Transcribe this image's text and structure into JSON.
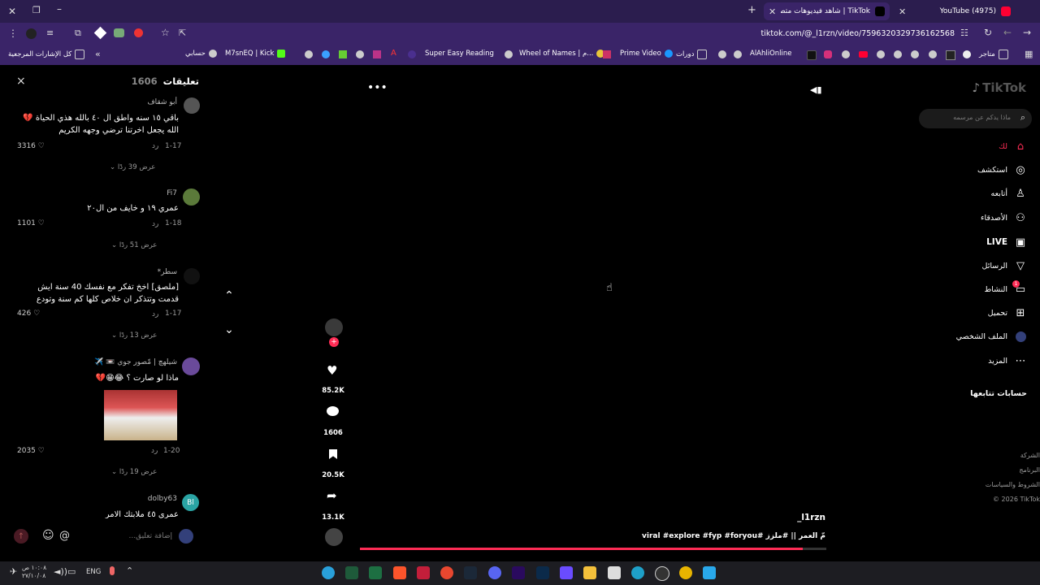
{
  "browser": {
    "tabs": [
      {
        "title": "TikTok | شاهد فيديوهات متصدرة",
        "active": true
      },
      {
        "title": "(4975) YouTube",
        "active": false
      }
    ],
    "new_tab_label": "+",
    "url": "tiktok.com/@_l1rzn/video/7596320329736162568"
  },
  "bookmarks": [
    {
      "label": "كل الإشارات المرجعية",
      "color": "#cccccc"
    },
    {
      "label": "حسابي",
      "color": "#cccccc"
    },
    {
      "label": "M7snEQ | Kick",
      "color": "#53fc18"
    },
    {
      "label": "Super Easy Reading",
      "color": "#4a2f8f"
    },
    {
      "label": "Wheel of Names | م...",
      "color": "#e8c53a"
    },
    {
      "label": "Prime Video",
      "color": "#1a98ff"
    },
    {
      "label": "دورات",
      "color": "#cccccc"
    },
    {
      "label": "AlAhliOnline",
      "color": "#cccccc"
    },
    {
      "label": "متاجر",
      "color": "#cccccc"
    }
  ],
  "comments_panel": {
    "title": "تعليقات",
    "count": "1606",
    "close": "×",
    "reply_label": "رد",
    "comments": [
      {
        "user": "أبو شقاف",
        "text": "باقي ١٥ سنه واطق ال ٤٠ بالله هذي الحياة 💔 الله يجعل اخرتنا ترضي وجهه الكريم",
        "date": "1-17",
        "likes": "3316",
        "replies": "عرض 39 ردًا"
      },
      {
        "user": "Fi7",
        "text": "عمري ١٩ و خايف من ال٢٠",
        "date": "1-18",
        "likes": "1101",
        "replies": "عرض 51 ردًا"
      },
      {
        "user": "سطر*",
        "text": "[ملصق] اخخ تفكر مع نفسك 40 سنة ايش قدمت وتتذكر ان خلاص كلها كم سنة وتودع",
        "date": "1-17",
        "likes": "426",
        "replies": "عرض 13 ردًا"
      },
      {
        "user": "شيلهچ | مّصور جوي 📼 ✈️",
        "text": "ماذا لو صارت ؟ 😂😁💔",
        "date": "1-20",
        "likes": "2035",
        "replies": "عرض 19 ردًا"
      },
      {
        "user": "dolby63",
        "text": "عمري ٤٥ ملابتك الامر",
        "date": "",
        "likes": "",
        "replies": ""
      }
    ],
    "input_placeholder": "إضافة تعليق...",
    "mention": "@"
  },
  "video": {
    "author": "_l1rzn",
    "caption": "مّ العمر || #ملزز #viral #explore #fyp #foryou",
    "progress": 0.95
  },
  "actions": {
    "likes": "85.2K",
    "comments": "1606",
    "saves": "20.5K",
    "shares": "13.1K"
  },
  "sidebar": {
    "logo": "TikTok",
    "search_placeholder": "ماذا يدكم عن مرسمه",
    "items": [
      {
        "label": "لك",
        "icon": "home-icon",
        "active": true
      },
      {
        "label": "استكشف",
        "icon": "compass-icon"
      },
      {
        "label": "أتابعه",
        "icon": "following-icon"
      },
      {
        "label": "الأصدقاء",
        "icon": "friends-icon"
      },
      {
        "label": "LIVE",
        "icon": "live-icon"
      },
      {
        "label": "الرسائل",
        "icon": "send-icon"
      },
      {
        "label": "النشاط",
        "icon": "activity-icon",
        "badge": "1"
      },
      {
        "label": "تحميل",
        "icon": "upload-icon"
      },
      {
        "label": "الملف الشخصي",
        "icon": "profile-icon"
      },
      {
        "label": "المزيد",
        "icon": "more-icon"
      }
    ],
    "following_heading": "حسابات تتابعها",
    "footer": [
      "الشركة",
      "البرنامج",
      "الشروط والسياسات",
      "© 2026 TikTok"
    ]
  },
  "taskbar": {
    "lang": "ENG",
    "time": "١٠:٠٨ ص",
    "date": "٢٧/١٠/٠٨"
  },
  "colors": {
    "accent": "#fe2c55",
    "tab_bar": "#2b1d4e",
    "toolbar": "#3a2468"
  }
}
